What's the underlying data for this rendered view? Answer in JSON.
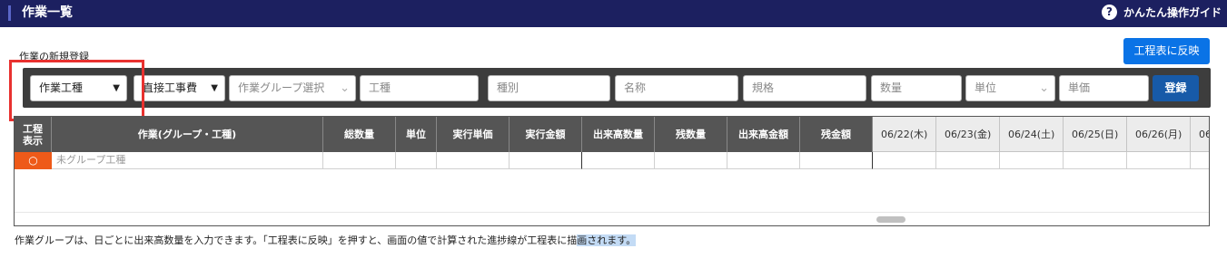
{
  "header": {
    "title": "作業一覧",
    "guide_label": "かんたん操作ガイド",
    "guide_icon": "?"
  },
  "section_label": "作業の新規登録",
  "reflect_button": "工程表に反映",
  "form": {
    "work_type": "作業工種",
    "cost_type": "直接工事費",
    "group_select": "作業グループ選択",
    "placeholders": {
      "koshu": "工種",
      "shubetsu": "種別",
      "meisho": "名称",
      "kikaku": "規格",
      "suryo": "数量",
      "tani": "単位",
      "tanka": "単価"
    },
    "register_button": "登録"
  },
  "table": {
    "headers": {
      "koutei": [
        "工程",
        "表示"
      ],
      "work": "作業(グループ・工種)",
      "total_qty": "総数量",
      "unit": "単位",
      "exec_unit_price": "実行単価",
      "exec_amount": "実行金額",
      "done_qty": "出来高数量",
      "remain_qty": "残数量",
      "done_amount": "出来高金額",
      "remain_amount": "残金額"
    },
    "dates": [
      "06/22(木)",
      "06/23(金)",
      "06/24(土)",
      "06/25(日)",
      "06/26(月)",
      "06"
    ],
    "rows": [
      {
        "indicator": "○",
        "name": "未グループ工種"
      }
    ]
  },
  "note": {
    "text": "作業グループは、日ごとに出来高数量を入力できます。「工程表に反映」を押すと、画面の値で計算された進捗線が工程表に描",
    "highlighted": "画されます。"
  },
  "colors": {
    "header_bg": "#1c2060",
    "accent_blue": "#0a73e6",
    "register_blue": "#175aa8",
    "indicator_orange": "#ee5a19",
    "highlight_red": "#e8312f"
  }
}
